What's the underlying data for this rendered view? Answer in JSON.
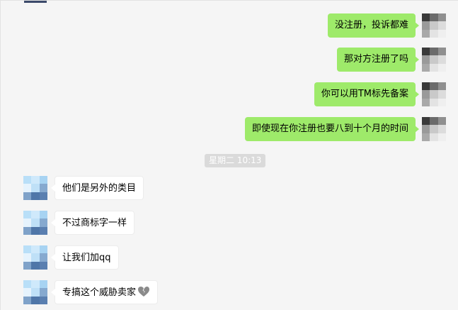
{
  "timestamp": "星期二 10:13",
  "messages_me": [
    {
      "text": "没注册，投诉都难"
    },
    {
      "text": "那对方注册了吗"
    },
    {
      "text": "你可以用TM标先备案"
    },
    {
      "text": "即使现在你注册也要八到十个月的时间"
    }
  ],
  "messages_other": [
    {
      "text": "他们是另外的类目"
    },
    {
      "text": "不过商标字一样"
    },
    {
      "text": "让我们加qq"
    },
    {
      "text": "专搞这个威胁卖家",
      "emoji": "broken-heart-icon"
    }
  ],
  "colors": {
    "bubble_me": "#9eea6a",
    "bubble_other": "#ffffff",
    "background": "#f5f5f5",
    "timestamp_bg": "#dadada"
  }
}
